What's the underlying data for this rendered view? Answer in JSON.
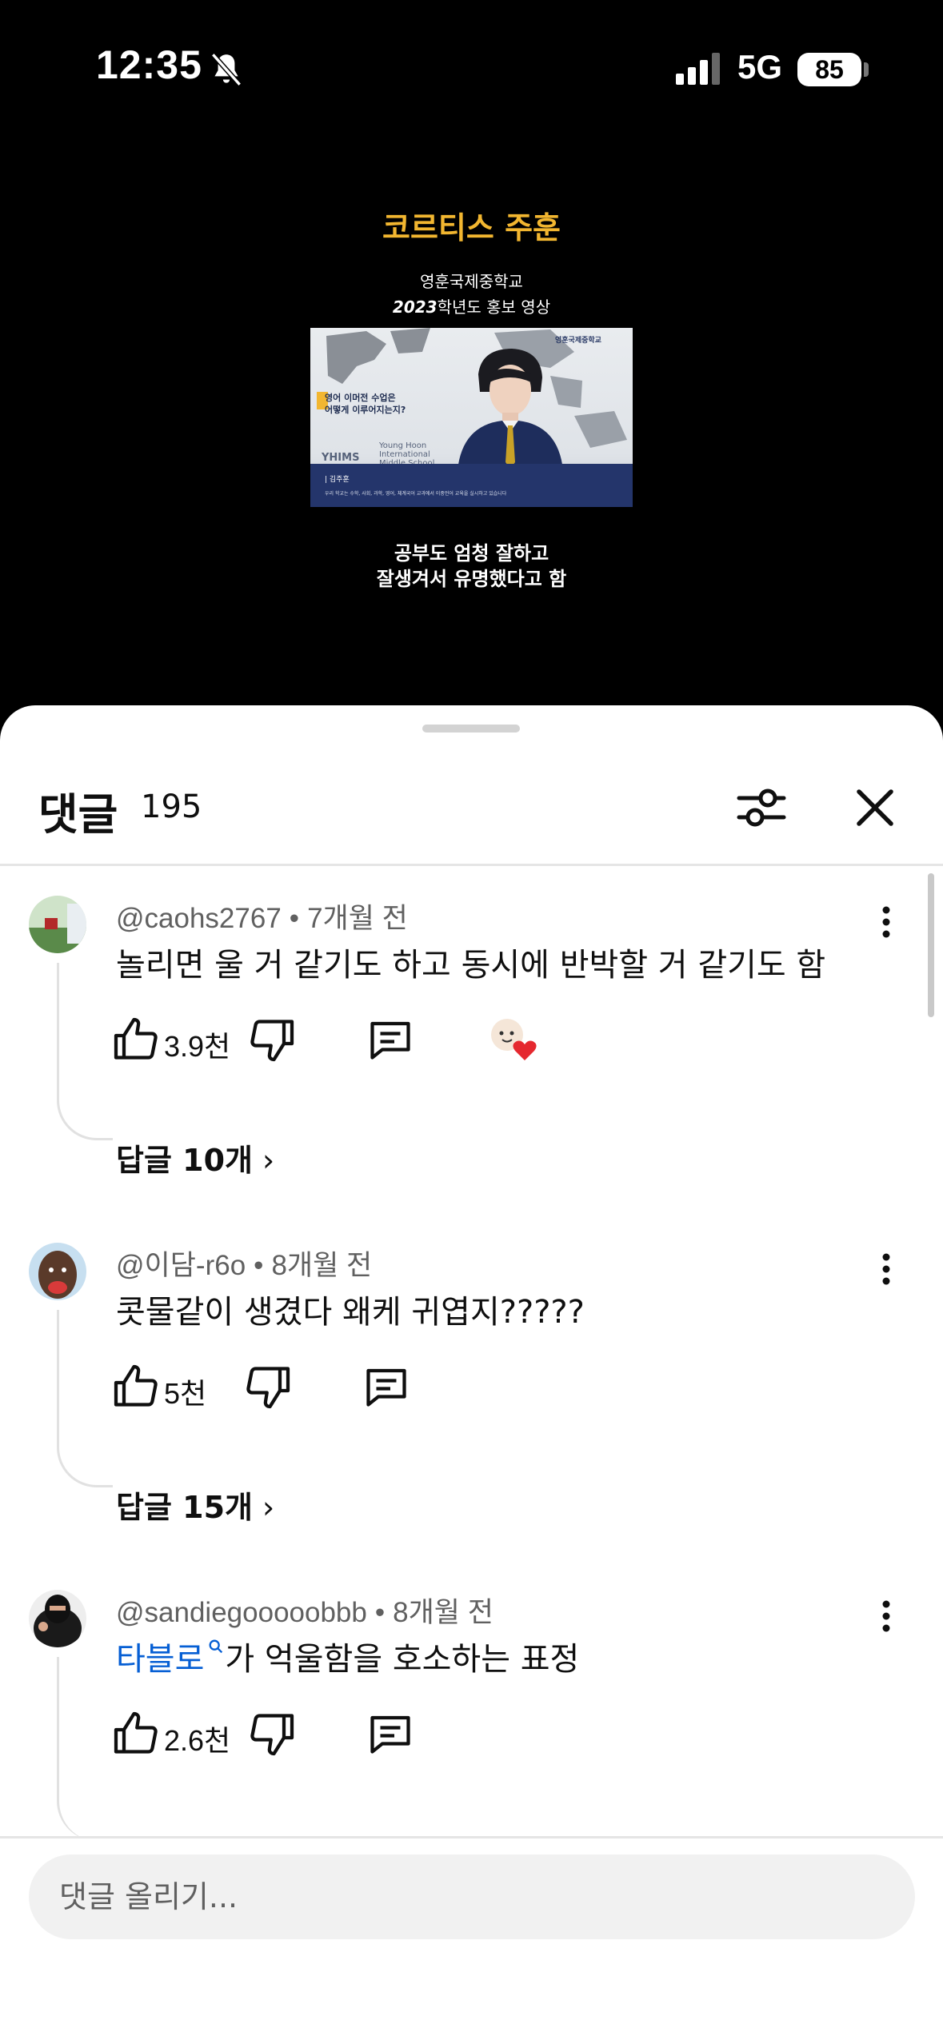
{
  "status_bar": {
    "time": "12:35",
    "network": "5G",
    "battery": "85"
  },
  "video": {
    "title": "코르티스 주훈",
    "subtitle_line1": "영훈국제중학교",
    "subtitle_line2_year": "2023",
    "subtitle_line2_rest": "학년도 홍보 영상",
    "thumbnail": {
      "badge": "영훈국제중학교",
      "question_line1": "영어 이머전 수업은",
      "question_line2": "어떻게 이루어지는지?",
      "school_line1": "Young Hoon",
      "school_line2": "International",
      "school_line3": "Middle School",
      "logo": "YHIMS",
      "name_tag": "| 김주훈",
      "caption": "우리 학교는 수학, 사회, 과학, 영어, 체계국어 교과에서 이중언어 교육을 실시하고 있습니다"
    },
    "bottom_line1": "공부도 엄청 잘하고",
    "bottom_line2": "잘생겨서 유명했다고 함"
  },
  "sheet": {
    "title": "댓글",
    "count": "195"
  },
  "comments": [
    {
      "author": "@caohs2767",
      "time": "7개월 전",
      "text": "놀리면 울 거 같기도 하고 동시에 반박할 거 같기도 함",
      "likes": "3.9천",
      "replies": "답글 10개"
    },
    {
      "author": "@이담-r6o",
      "time": "8개월 전",
      "text": "콧물같이 생겼다 왜케 귀엽지?????",
      "likes": "5천",
      "replies": "답글 15개"
    },
    {
      "author": "@sandiegooooobbb",
      "time": "8개월 전",
      "text_link": "타블로",
      "text_rest": "가 억울함을 호소하는 표정",
      "likes": "2.6천"
    }
  ],
  "input": {
    "placeholder": "댓글 올리기..."
  },
  "colors": {
    "video_title": "#f2b630",
    "link": "#065fd4",
    "heart": "#e5282f"
  },
  "icons": [
    "bell-slash-icon",
    "signal-icon",
    "filter-icon",
    "close-icon",
    "more-vert-icon",
    "thumb-up-icon",
    "thumb-down-icon",
    "reply-icon",
    "creator-heart-icon",
    "chevron-right-icon",
    "search-icon"
  ]
}
